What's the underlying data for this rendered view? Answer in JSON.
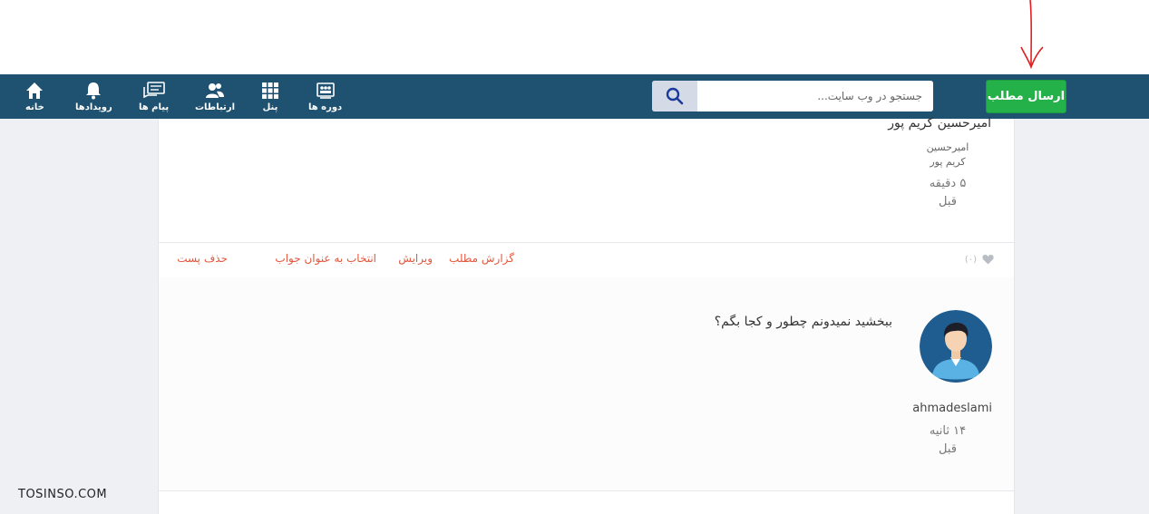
{
  "header": {
    "submit_label": "ارسال مطلب",
    "search_placeholder": "جستجو در وب سایت...",
    "nav": [
      {
        "label": "دوره ها",
        "icon": "courses-icon"
      },
      {
        "label": "پنل",
        "icon": "grid-icon"
      },
      {
        "label": "ارتباطات",
        "icon": "people-icon"
      },
      {
        "label": "پیام ها",
        "icon": "messages-icon"
      },
      {
        "label": "رویدادها",
        "icon": "bell-icon"
      },
      {
        "label": "خانه",
        "icon": "home-icon"
      }
    ]
  },
  "post": {
    "author_name": "امیرحسین کریم پور",
    "author_sub_line1": "امیرحسین",
    "author_sub_line2": "کریم پور",
    "time_line1": "۵ دقیقه",
    "time_line2": "قبل",
    "like_count": "(۰)",
    "actions": {
      "report": "گزارش مطلب",
      "edit": "ویرایش",
      "select_answer": "انتخاب به عنوان جواب",
      "delete": "حذف پست"
    }
  },
  "reply": {
    "text": "ببخشید نمیدونم چطور و کجا بگم؟",
    "username": "ahmadeslami",
    "time_line1": "۱۴ ثانیه",
    "time_line2": "قبل"
  },
  "watermark": "TOSINSO.COM",
  "colors": {
    "navbar": "#1f5170",
    "submit": "#25b14a",
    "action_link": "#e4573d",
    "annotation_arrow": "#e02020"
  }
}
